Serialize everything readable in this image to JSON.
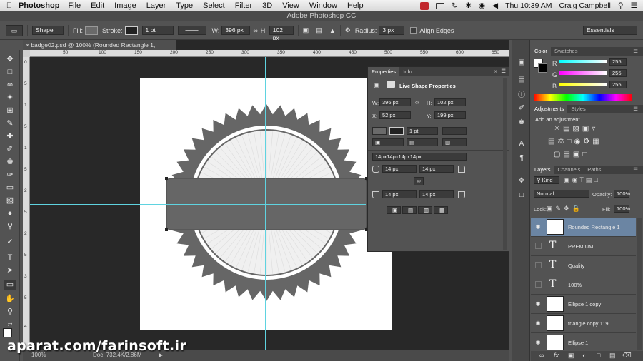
{
  "menubar": {
    "app_name": "Photoshop",
    "menus": [
      "File",
      "Edit",
      "Image",
      "Layer",
      "Type",
      "Select",
      "Filter",
      "3D",
      "View",
      "Window",
      "Help"
    ],
    "clock": "Thu 10:39 AM",
    "user": "Craig Campbell"
  },
  "window": {
    "title": "Adobe Photoshop CC"
  },
  "options": {
    "mode": "Shape",
    "fill_label": "Fill:",
    "stroke_label": "Stroke:",
    "stroke_width": "1 pt",
    "w_label": "W:",
    "w_value": "396 px",
    "h_label": "H:",
    "h_value": "102 px",
    "radius_label": "Radius:",
    "radius_value": "3 px",
    "align_edges": "Align Edges",
    "workspace": "Essentials"
  },
  "document": {
    "tab_title": "badge02.psd @ 100% (Rounded Rectangle 1, RGB/8) *",
    "zoom": "100%",
    "doc_info": "Doc: 732.4K/2.86M",
    "ruler_top": [
      "50",
      "100",
      "150",
      "200",
      "250",
      "300",
      "350",
      "400",
      "450",
      "500",
      "550",
      "600",
      "650"
    ],
    "ruler_left": [
      "0",
      "5",
      "1",
      "5",
      "1",
      "5",
      "2",
      "5",
      "2",
      "5",
      "3",
      "5",
      "4"
    ]
  },
  "properties": {
    "tabs": [
      "Properties",
      "Info"
    ],
    "header": "Live Shape Properties",
    "w_label": "W:",
    "w_value": "396 px",
    "h_label": "H:",
    "h_value": "102 px",
    "x_label": "X:",
    "x_value": "52 px",
    "y_label": "Y:",
    "y_value": "199 px",
    "stroke_width": "1 pt",
    "corner_radii": "14px14px14px14px",
    "tl": "14 px",
    "tr": "14 px",
    "bl": "14 px",
    "br": "14 px"
  },
  "color_panel": {
    "tabs": [
      "Color",
      "Swatches"
    ],
    "r_label": "R",
    "r": "255",
    "g_label": "G",
    "g": "255",
    "b_label": "B",
    "b": "255"
  },
  "adjustments_panel": {
    "tabs": [
      "Adjustments",
      "Styles"
    ],
    "title": "Add an adjustment"
  },
  "layers_panel": {
    "tabs": [
      "Layers",
      "Channels",
      "Paths"
    ],
    "kind": "Kind",
    "blend_mode": "Normal",
    "opacity_label": "Opacity:",
    "opacity": "100%",
    "lock_label": "Lock:",
    "fill_label": "Fill:",
    "fill": "100%",
    "layers": [
      {
        "name": "Rounded Rectangle 1",
        "type": "shape",
        "visible": true,
        "selected": true
      },
      {
        "name": "PREMIUM",
        "type": "text",
        "visible": false,
        "selected": false
      },
      {
        "name": "Quality",
        "type": "text",
        "visible": false,
        "selected": false
      },
      {
        "name": "100%",
        "type": "text",
        "visible": false,
        "selected": false
      },
      {
        "name": "Ellipse 1 copy",
        "type": "shape",
        "visible": true,
        "selected": false
      },
      {
        "name": "triangle copy 119",
        "type": "shape",
        "visible": true,
        "selected": false
      },
      {
        "name": "Ellipse 1",
        "type": "shape",
        "visible": true,
        "selected": false
      }
    ],
    "footer_fx": "fx"
  },
  "watermark": "aparat.com/farinsoft.ir",
  "colors": {
    "badge_gray": "#666666",
    "selection_blue": "#6b85a3",
    "guide": "#5fd3e0"
  }
}
